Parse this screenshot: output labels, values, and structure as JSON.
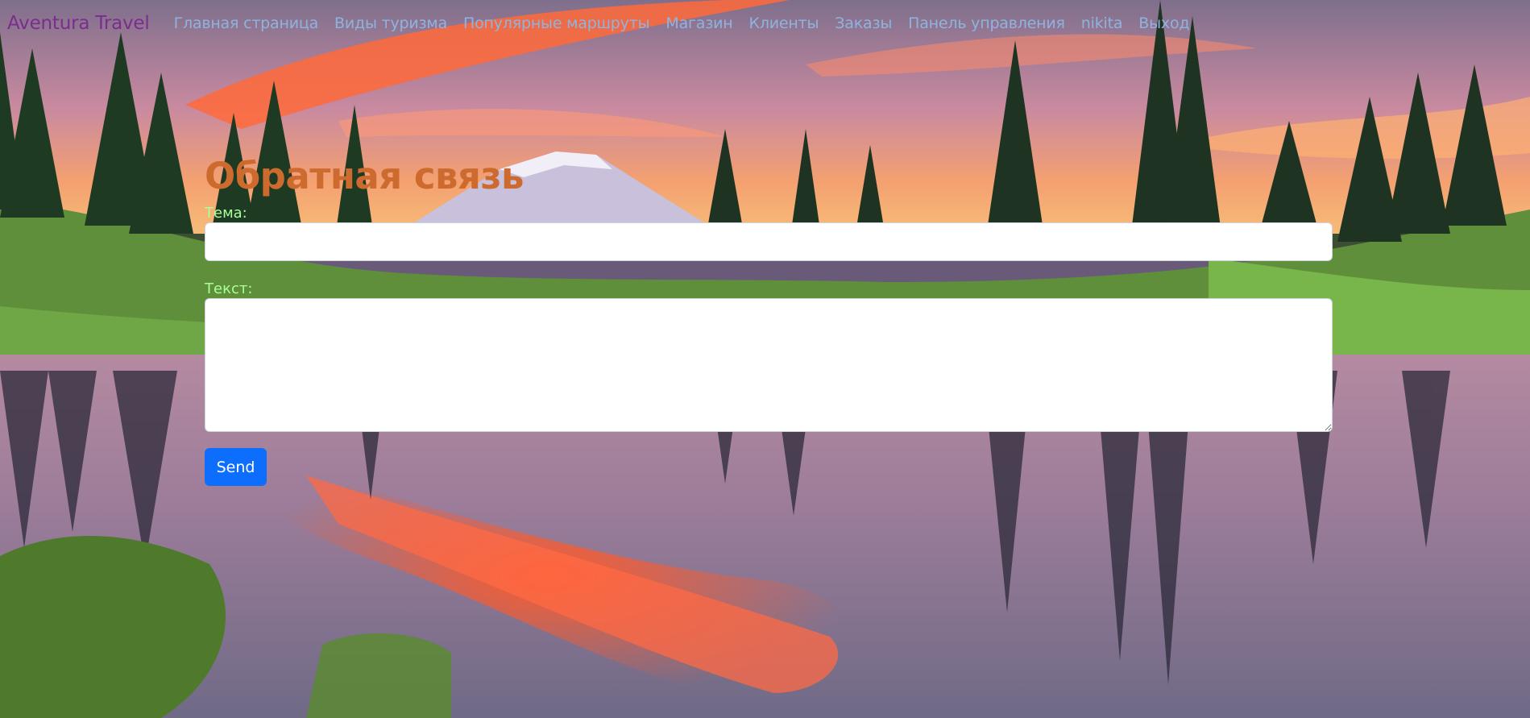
{
  "navbar": {
    "brand": "Aventura Travel",
    "links": [
      {
        "label": "Главная страница"
      },
      {
        "label": "Виды туризма"
      },
      {
        "label": "Популярные маршруты"
      },
      {
        "label": "Магазин"
      },
      {
        "label": "Клиенты"
      },
      {
        "label": "Заказы"
      },
      {
        "label": "Панель управления"
      },
      {
        "label": "nikita"
      },
      {
        "label": "Выход"
      }
    ]
  },
  "form": {
    "title": "Обратная связь",
    "subject_label": "Тема:",
    "subject_value": "",
    "text_label": "Текст:",
    "text_value": "",
    "send_label": "Send"
  },
  "colors": {
    "brand": "#7b2d8e",
    "nav_link": "#8fb3e0",
    "title": "#cd6a2e",
    "label": "#a8ff9a",
    "button": "#0d6efd"
  },
  "background": {
    "description_icon": "mountain-lake-sunset-background"
  }
}
